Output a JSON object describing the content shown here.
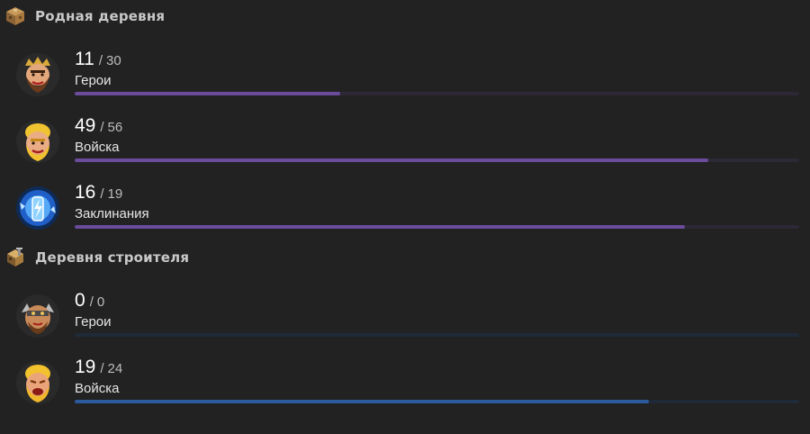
{
  "sections": [
    {
      "title": "Родная деревня",
      "icon": "town-hall-icon",
      "track_color": "#2d2836",
      "fill_color": "#6a4b9c",
      "rows": [
        {
          "current": "11",
          "sep": "/",
          "max": "30",
          "label": "Герои",
          "progress": 0.367,
          "avatar": "barbarian-king-icon"
        },
        {
          "current": "49",
          "sep": "/",
          "max": "56",
          "label": "Войска",
          "progress": 0.875,
          "avatar": "barbarian-icon"
        },
        {
          "current": "16",
          "sep": "/",
          "max": "19",
          "label": "Заклинания",
          "progress": 0.842,
          "avatar": "lightning-spell-icon"
        }
      ]
    },
    {
      "title": "Деревня строителя",
      "icon": "builder-hall-icon",
      "track_color": "#1f2a38",
      "fill_color": "#2c5a9c",
      "rows": [
        {
          "current": "0",
          "sep": "/",
          "max": "0",
          "label": "Герои",
          "progress": 0,
          "avatar": "battle-machine-icon"
        },
        {
          "current": "19",
          "sep": "/",
          "max": "24",
          "label": "Войска",
          "progress": 0.792,
          "avatar": "raged-barbarian-icon"
        }
      ]
    }
  ]
}
